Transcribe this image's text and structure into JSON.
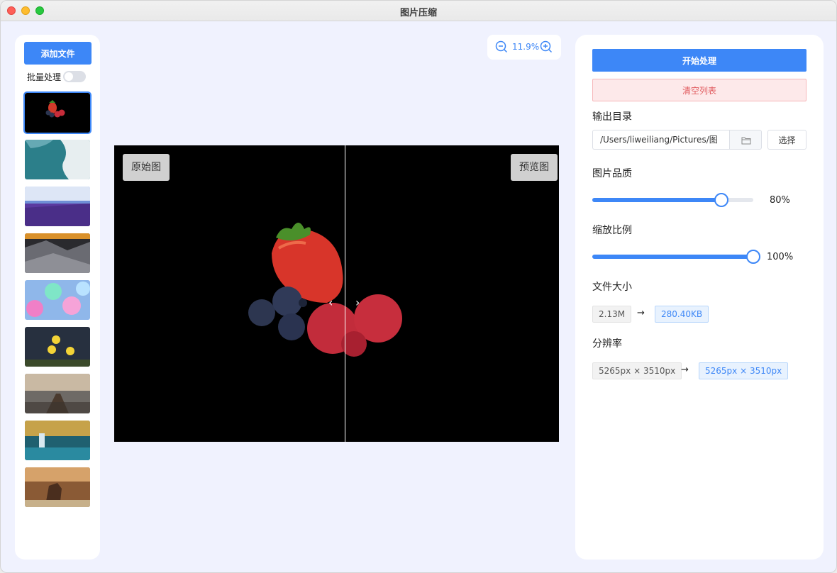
{
  "window": {
    "title": "图片压缩"
  },
  "sidebar": {
    "add_label": "添加文件",
    "batch_label": "批量处理",
    "batch_enabled": false,
    "thumbnails": [
      {
        "name": "thumb-strawberries",
        "selected": true
      },
      {
        "name": "thumb-coast"
      },
      {
        "name": "thumb-lavender"
      },
      {
        "name": "thumb-mountains"
      },
      {
        "name": "thumb-bokeh"
      },
      {
        "name": "thumb-flowers"
      },
      {
        "name": "thumb-boardwalk"
      },
      {
        "name": "thumb-waterfall"
      },
      {
        "name": "thumb-deer"
      }
    ]
  },
  "zoom": {
    "value": "11.9%"
  },
  "preview": {
    "original_label": "原始图",
    "preview_label": "预览图"
  },
  "panel": {
    "start_label": "开始处理",
    "clear_label": "清空列表",
    "output_dir_label": "输出目录",
    "output_dir_value": "/Users/liweiliang/Pictures/图",
    "choose_label": "选择",
    "quality_label": "图片品质",
    "quality_value": "80%",
    "quality_fraction": 0.8,
    "scale_label": "缩放比例",
    "scale_value": "100%",
    "scale_fraction": 1.0,
    "filesize_label": "文件大小",
    "filesize_from": "2.13M",
    "filesize_to": "280.40KB",
    "resolution_label": "分辨率",
    "resolution_from": "5265px × 3510px",
    "resolution_to": "5265px × 3510px",
    "arrow": "→"
  },
  "colors": {
    "accent": "#3d87f7",
    "danger": "#e15b5f",
    "background": "#f0f2fe"
  }
}
